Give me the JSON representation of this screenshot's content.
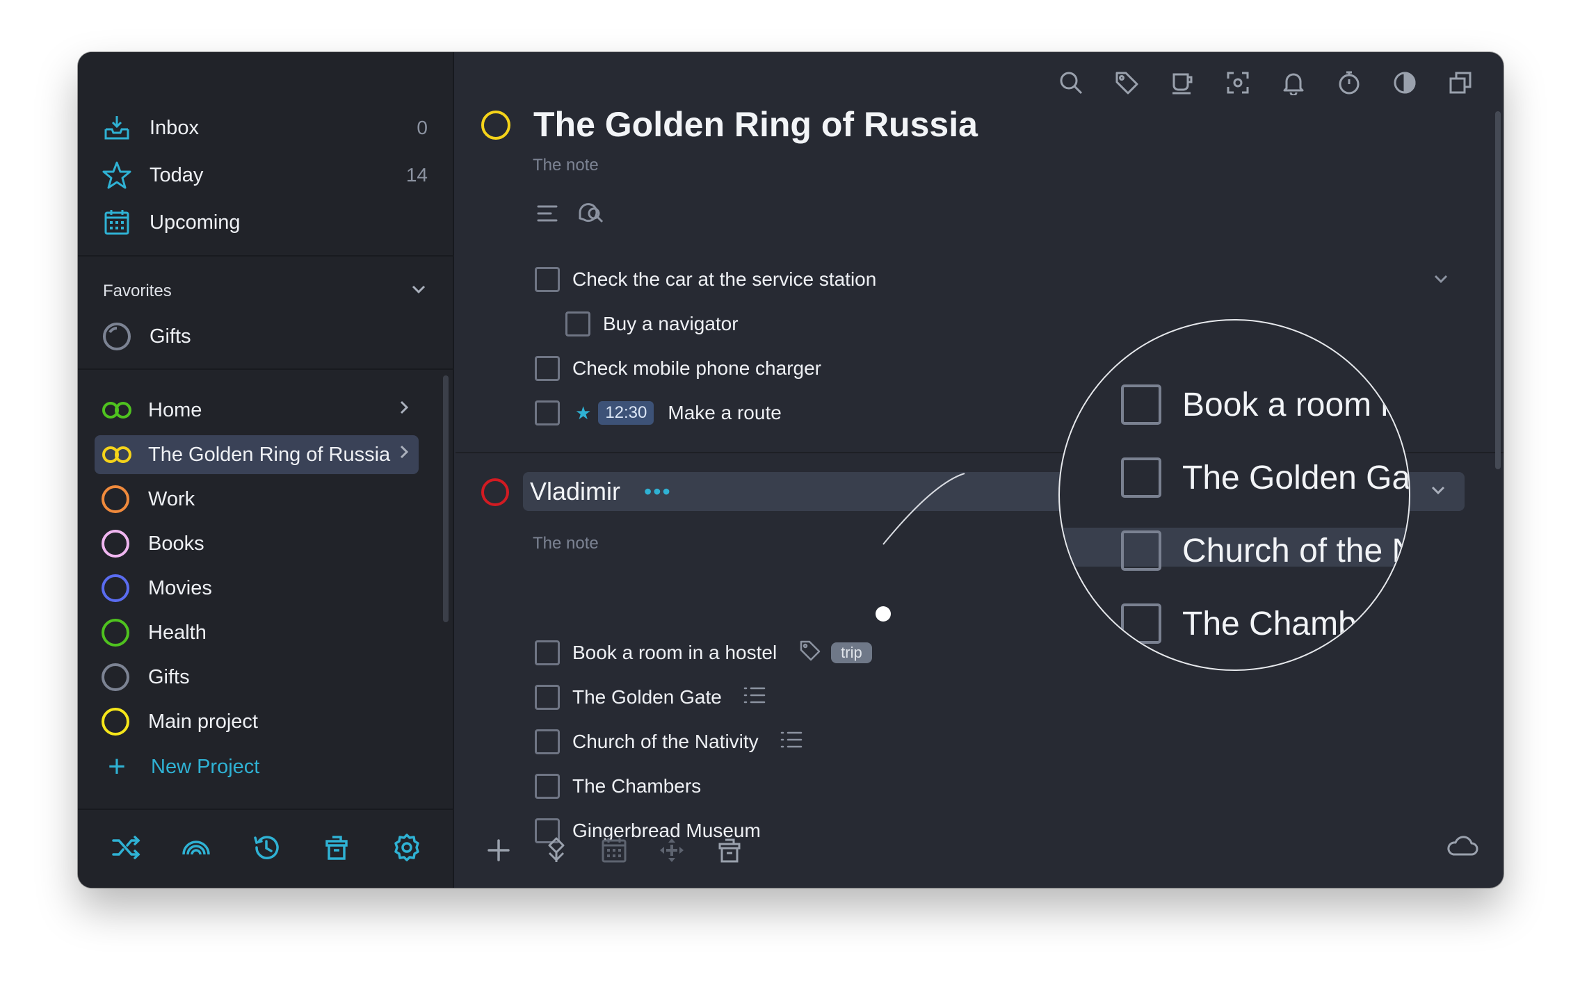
{
  "window": {
    "traffic_colors": [
      "#ff5f57",
      "#febc2e",
      "#28c840"
    ]
  },
  "sidebar": {
    "nav": [
      {
        "label": "Inbox",
        "count": "0",
        "icon": "inbox-icon"
      },
      {
        "label": "Today",
        "count": "14",
        "icon": "star-icon"
      },
      {
        "label": "Upcoming",
        "count": "",
        "icon": "calendar-icon"
      }
    ],
    "favorites": {
      "heading": "Favorites",
      "items": [
        {
          "label": "Gifts",
          "icon": "partial-circle-icon"
        }
      ]
    },
    "projects": [
      {
        "label": "Home",
        "color": "#4fc21f",
        "type": "rings",
        "has_children": true
      },
      {
        "label": "The Golden Ring of Russia",
        "color": "#f5d31a",
        "type": "rings",
        "has_children": true,
        "active": true
      },
      {
        "label": "Work",
        "color": "#f08a3c",
        "type": "ring"
      },
      {
        "label": "Books",
        "color": "#f0b6f0",
        "type": "ring"
      },
      {
        "label": "Movies",
        "color": "#5a6cf0",
        "type": "ring"
      },
      {
        "label": "Health",
        "color": "#4fc21f",
        "type": "ring"
      },
      {
        "label": "Gifts",
        "color": "#7c8393",
        "type": "ring"
      },
      {
        "label": "Main project",
        "color": "#f5e61a",
        "type": "ring"
      }
    ],
    "new_project_label": "New Project",
    "bottom_icons": [
      "shuffle-icon",
      "rainbow-icon",
      "history-icon",
      "trash-icon",
      "settings-icon"
    ]
  },
  "toolbar": {
    "icons": [
      "search-icon",
      "tag-icon",
      "cup-icon",
      "focus-icon",
      "bell-icon",
      "timer-icon",
      "contrast-icon",
      "windows-icon"
    ]
  },
  "project": {
    "title": "The Golden Ring of Russia",
    "note": "The note",
    "accent": "#f5d31a",
    "tasks": [
      {
        "label": "Check the car at the service station",
        "indent": 0
      },
      {
        "label": "Buy a navigator",
        "indent": 1
      },
      {
        "label": "Check mobile phone charger",
        "indent": 0
      },
      {
        "label": "Make a route",
        "indent": 0,
        "starred": true,
        "time": "12:30"
      }
    ]
  },
  "heading": {
    "title": "Vladimir",
    "dots": "•••",
    "note": "The note",
    "accent": "#d21b22",
    "tasks": [
      {
        "label": "Book a room in a hostel",
        "tag": "trip",
        "has_tag_icon": true
      },
      {
        "label": "The Golden Gate",
        "has_list_icon": true
      },
      {
        "label": "Church of the Nativity",
        "has_list_icon": true
      },
      {
        "label": "The Chambers"
      },
      {
        "label": "Gingerbread Museum"
      }
    ]
  },
  "magnifier": {
    "rows": [
      "Book a room i",
      "The Golden Gat",
      "Church of the N",
      "The Chamb"
    ]
  },
  "bottom_toolbar": {
    "icons": [
      "add-icon",
      "move-icon",
      "calendar-icon",
      "drag-icon",
      "trash-icon"
    ],
    "sync_icon": "cloud-icon"
  }
}
